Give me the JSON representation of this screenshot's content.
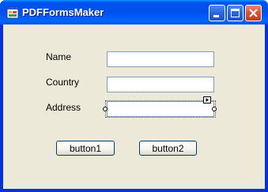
{
  "window": {
    "title": "PDFFormsMaker",
    "controls": {
      "minimize_icon": "minimize-icon",
      "maximize_icon": "maximize-icon",
      "close_icon": "close-icon"
    },
    "accent": "#0054e3"
  },
  "form": {
    "fields": [
      {
        "label": "Name",
        "value": ""
      },
      {
        "label": "Country",
        "value": ""
      },
      {
        "label": "Address",
        "value": ""
      }
    ],
    "buttons": [
      {
        "label": "button1"
      },
      {
        "label": "button2"
      }
    ]
  }
}
